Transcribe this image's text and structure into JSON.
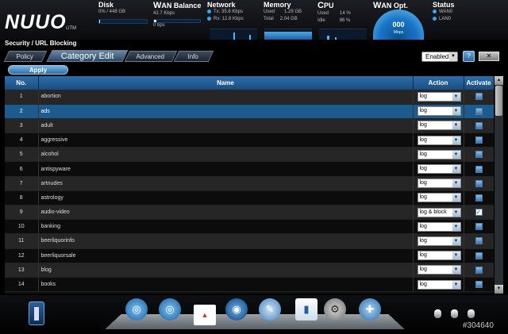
{
  "app": {
    "logo": "nuuo",
    "logo_sub": "UTM"
  },
  "status_panels": {
    "disk": {
      "title": "Disk",
      "line1": "0% / 448 GB",
      "line2": "1",
      "level": 0
    },
    "wan_balance": {
      "title_big": "W",
      "title": "AN Balance",
      "line1": "42.7 Kbps",
      "line2": "0 bps"
    },
    "network": {
      "title": "Network",
      "tx": "Tx: 35.8 Kbps",
      "rx": "Rx: 12.8 Kbps"
    },
    "memory": {
      "title": "Memory",
      "used": "Used",
      "used_v": "1.29 GB",
      "total": "Total",
      "total_v": "2.04 GB"
    },
    "cpu": {
      "title_big": "C",
      "title": "PU",
      "used": "Used",
      "used_v": "14 %",
      "idle": "Idle",
      "idle_v": "86 %"
    },
    "wan_opt": {
      "title_big": "W",
      "title": "AN Opt.",
      "value": "000",
      "unit": "Mbps"
    },
    "status": {
      "title": "Status",
      "wan": "WAN0",
      "lan": "LAN0"
    }
  },
  "breadcrumb": "Security / URL Blocking",
  "tabs": [
    {
      "label": "Policy"
    },
    {
      "label": "Category Edit"
    },
    {
      "label": "Advanced"
    },
    {
      "label": "Info"
    }
  ],
  "active_tab": 1,
  "apply_label": "Apply",
  "enabled_select": {
    "value": "Enabled"
  },
  "close_label": "✕",
  "table": {
    "headers": {
      "no": "No.",
      "name": "Name",
      "action": "Action",
      "activate": "Activate"
    },
    "rows": [
      {
        "no": "1",
        "name": "abortion",
        "action": "log",
        "activate": false
      },
      {
        "no": "2",
        "name": "ads",
        "action": "log",
        "activate": false
      },
      {
        "no": "3",
        "name": "adult",
        "action": "log",
        "activate": false
      },
      {
        "no": "4",
        "name": "aggressive",
        "action": "log",
        "activate": false
      },
      {
        "no": "5",
        "name": "alcohol",
        "action": "log",
        "activate": false
      },
      {
        "no": "6",
        "name": "antispyware",
        "action": "log",
        "activate": false
      },
      {
        "no": "7",
        "name": "artnudes",
        "action": "log",
        "activate": false
      },
      {
        "no": "8",
        "name": "astrology",
        "action": "log",
        "activate": false
      },
      {
        "no": "9",
        "name": "audio-video",
        "action": "log & block",
        "activate": true
      },
      {
        "no": "10",
        "name": "banking",
        "action": "log",
        "activate": false
      },
      {
        "no": "11",
        "name": "beerliquorinfo",
        "action": "log",
        "activate": false
      },
      {
        "no": "12",
        "name": "beerliquorsale",
        "action": "log",
        "activate": false
      },
      {
        "no": "13",
        "name": "blog",
        "action": "log",
        "activate": false
      },
      {
        "no": "14",
        "name": "books",
        "action": "log",
        "activate": false
      }
    ],
    "selected_row": 1
  },
  "watermark": "#304640"
}
